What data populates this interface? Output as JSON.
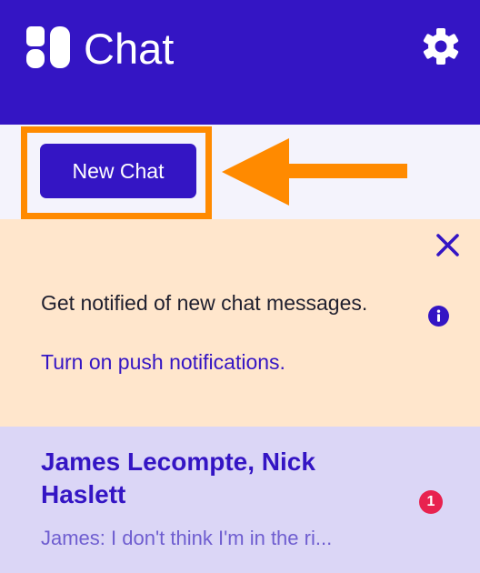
{
  "header": {
    "title": "Chat",
    "logo_icon": "app-logo-icon",
    "settings_icon": "gear-icon",
    "background": "#3415c4"
  },
  "toolbar": {
    "new_chat_label": "New Chat",
    "highlight_color": "#ff8a00"
  },
  "banner": {
    "message": "Get notified of new chat messages.",
    "link_text": "Turn on push notifications.",
    "close_icon": "close-icon",
    "info_icon": "info-icon",
    "background": "#ffe6cc"
  },
  "chat_list": [
    {
      "name": "James Lecompte, Nick Haslett",
      "preview": "James: I don't think I'm in the ri...",
      "unread_count": "1"
    }
  ],
  "colors": {
    "accent": "#3415c4",
    "badge": "#e8224f",
    "annotation": "#ff8a00"
  }
}
